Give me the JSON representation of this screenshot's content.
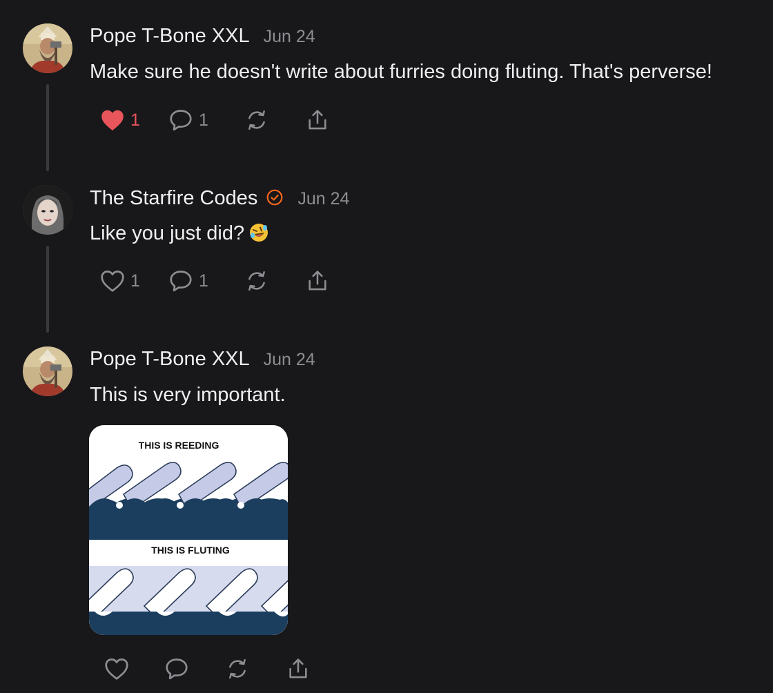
{
  "comments": [
    {
      "author": "Pope T-Bone XXL",
      "date": "Jun 24",
      "text": "Make sure he doesn't write about furries doing fluting. That's perverse!",
      "likes": "1",
      "liked": true,
      "replies": "1"
    },
    {
      "author": "The Starfire Codes",
      "date": "Jun 24",
      "text": "Like you just did?",
      "emoji": "rolling-on-floor-laughing",
      "verified": true,
      "likes": "1",
      "liked": false,
      "replies": "1"
    },
    {
      "author": "Pope T-Bone XXL",
      "date": "Jun 24",
      "text": "This is very important.",
      "likes": "",
      "liked": false,
      "replies": "",
      "image": {
        "top_caption": "THIS IS REEDING",
        "bottom_caption": "THIS IS FLUTING"
      }
    }
  ],
  "icons": {
    "like": "heart-icon",
    "reply": "speech-bubble-icon",
    "restack": "restack-icon",
    "share": "share-icon",
    "verified": "verified-check-icon"
  },
  "colors": {
    "background": "#18181b",
    "liked": "#e8555a",
    "verified": "#ff6719",
    "muted": "#8d8d92"
  }
}
